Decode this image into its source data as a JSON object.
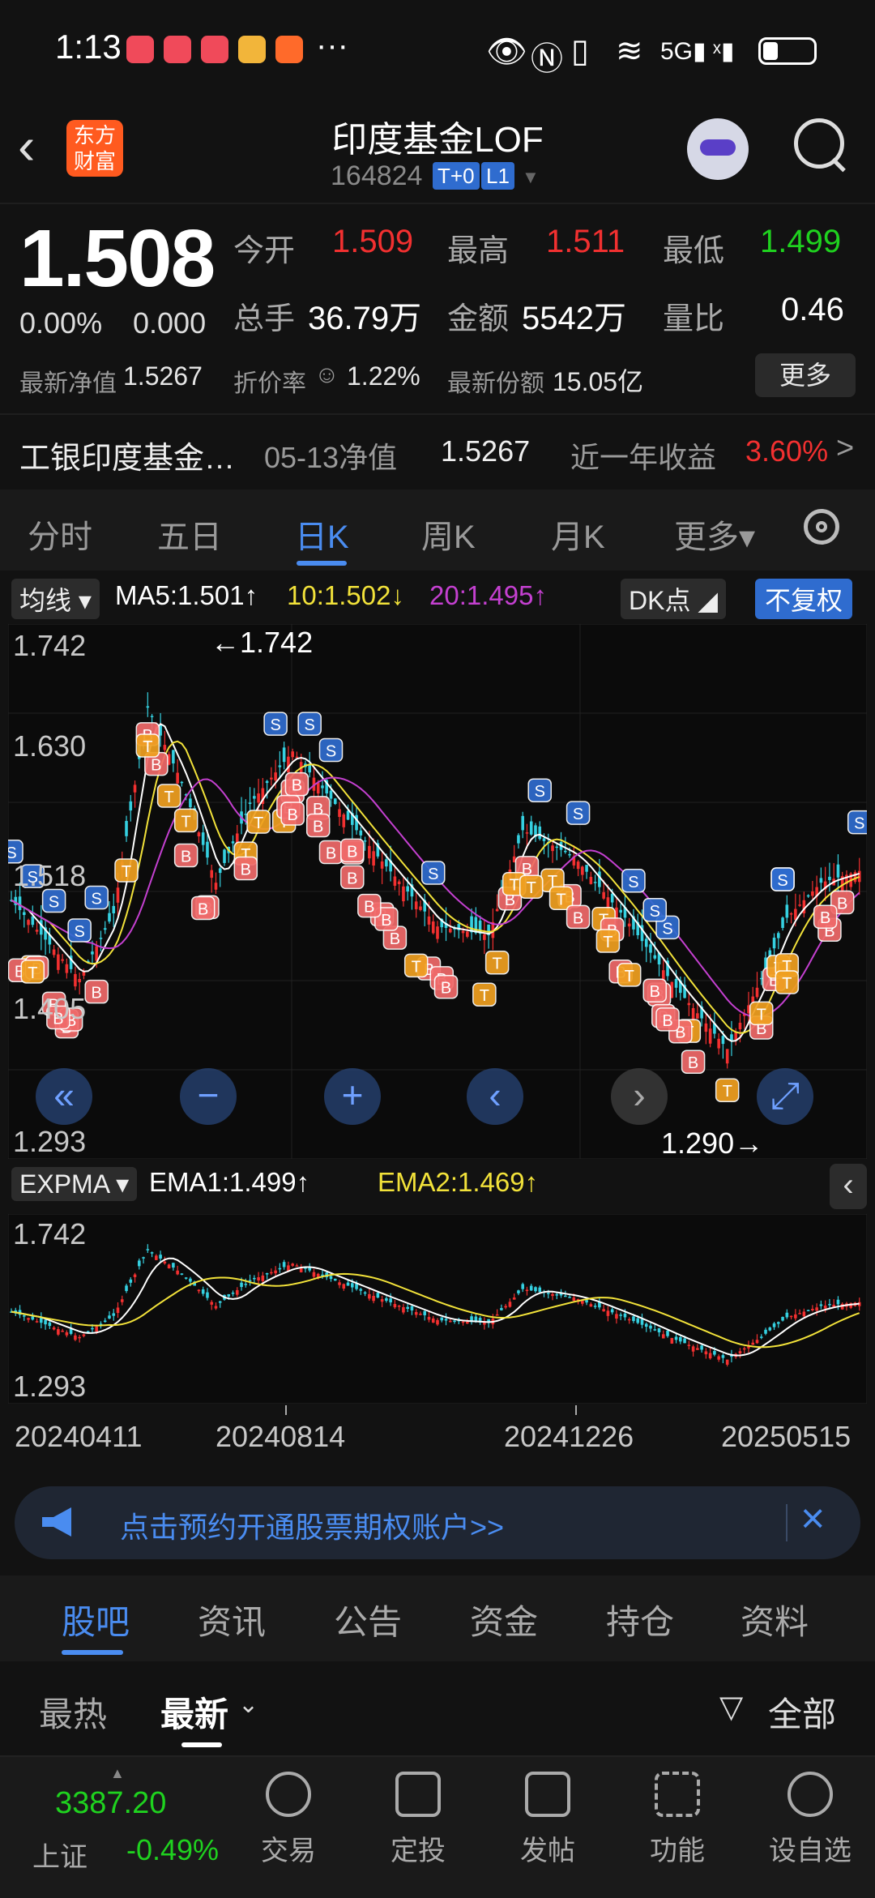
{
  "status_bar": {
    "time": "1:13",
    "extra": "···"
  },
  "header": {
    "back_icon": "chevron-left-icon",
    "logo_text": "东方\n财富",
    "title": "印度基金LOF",
    "code": "164824",
    "tags": [
      "T+0",
      "L1"
    ]
  },
  "quote": {
    "price": "1.508",
    "change_pct": "0.00%",
    "change_abs": "0.000",
    "open_label": "今开",
    "open": "1.509",
    "high_label": "最高",
    "high": "1.511",
    "low_label": "最低",
    "low": "1.499",
    "volume_label": "总手",
    "volume": "36.79万",
    "amount_label": "金额",
    "amount": "5542万",
    "ratio_label": "量比",
    "ratio": "0.46",
    "nav_label": "最新净值",
    "nav": "1.5267",
    "discount_label": "折价率",
    "discount": "1.22%",
    "shares_label": "最新份额",
    "shares": "15.05亿",
    "more_button": "更多"
  },
  "fund_row": {
    "name": "工银印度基金…",
    "date_label": "05-13净值",
    "nav": "1.5267",
    "yield_label": "近一年收益",
    "yield": "3.60%",
    "arrow": ">"
  },
  "chart_tabs": {
    "items": [
      "分时",
      "五日",
      "日K",
      "周K",
      "月K",
      "更多▾"
    ],
    "active": "日K"
  },
  "ma_row": {
    "selector": "均线 ▾",
    "ma5": "MA5:1.501↑",
    "ma10": "10:1.502↓",
    "ma20": "20:1.495↑",
    "dk_button": "DK点 ◢",
    "restore_button": "不复权"
  },
  "main_chart": {
    "y_top": "1.742",
    "y_mid1": "1.630",
    "y_mid2": "1.518",
    "y_low": "1.405",
    "y_bottom": "1.293",
    "max_annot": "←1.742",
    "min_annot": "1.290→"
  },
  "sub_chart": {
    "selector": "EXPMA ▾",
    "ema1": "EMA1:1.499↑",
    "ema2": "EMA2:1.469↑",
    "y_top": "1.742",
    "y_bottom": "1.293",
    "collapse_icon": "chevron-left-icon"
  },
  "x_axis": {
    "labels": [
      "20240411",
      "20240814",
      "20241226",
      "20250515"
    ]
  },
  "banner": {
    "text": "点击预约开通股票期权账户>>",
    "icon": "megaphone-icon",
    "close_icon": "close-icon"
  },
  "bottom_tabs": {
    "items": [
      "股吧",
      "资讯",
      "公告",
      "资金",
      "持仓",
      "资料"
    ],
    "active": "股吧"
  },
  "sort_row": {
    "hot": "最热",
    "latest": "最新",
    "filter": "全部"
  },
  "footer": {
    "index_value": "3387.20",
    "index_name": "上证",
    "index_change": "-0.49%",
    "items": [
      {
        "label": "交易",
        "icon": "trade-icon"
      },
      {
        "label": "定投",
        "icon": "invest-icon"
      },
      {
        "label": "发帖",
        "icon": "edit-icon"
      },
      {
        "label": "功能",
        "icon": "grid-icon"
      },
      {
        "label": "设自选",
        "icon": "add-watchlist-icon"
      }
    ]
  },
  "colors": {
    "up": "#f23030",
    "down": "#1fd21f",
    "accent": "#4a8cf0",
    "ma5": "#ffffff",
    "ma10": "#f2e23a",
    "ma20": "#c440d0"
  }
}
